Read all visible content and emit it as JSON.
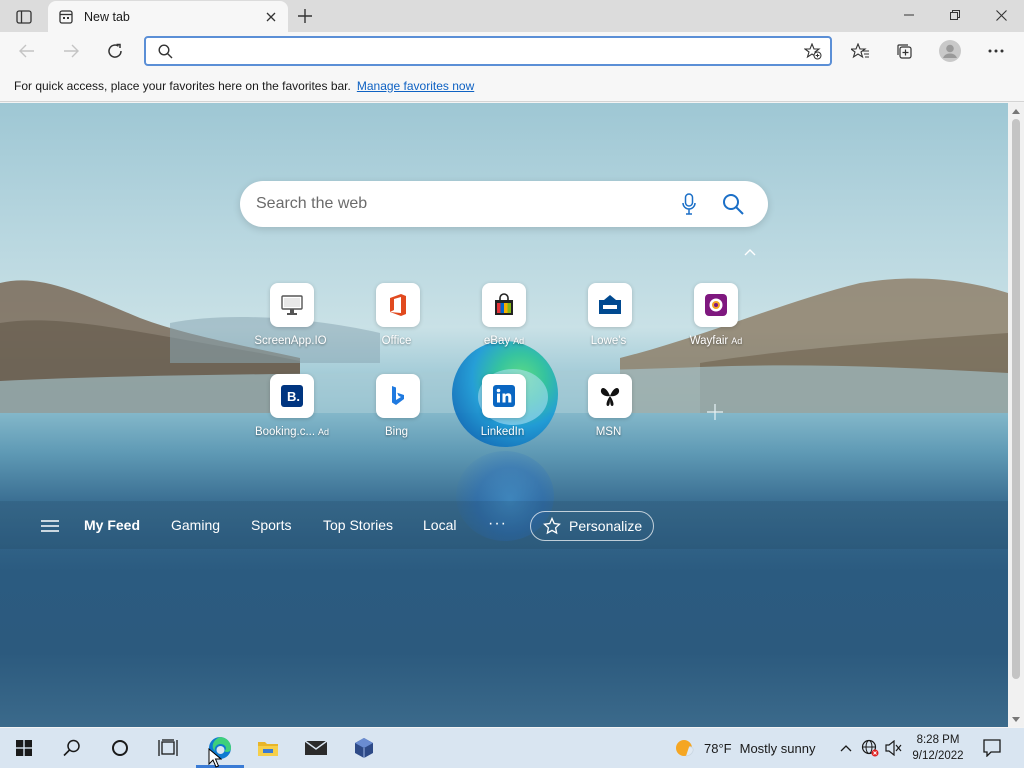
{
  "window": {
    "tab_title": "New tab"
  },
  "toolbar": {
    "address_value": "",
    "address_placeholder": ""
  },
  "favorites_bar": {
    "message": "For quick access, place your favorites here on the favorites bar.",
    "link": "Manage favorites now"
  },
  "newtab": {
    "search_placeholder": "Search the web",
    "tiles": [
      {
        "label": "ScreenApp.IO",
        "ad": ""
      },
      {
        "label": "Office",
        "ad": ""
      },
      {
        "label": "eBay",
        "ad": "Ad"
      },
      {
        "label": "Lowe's",
        "ad": ""
      },
      {
        "label": "Wayfair",
        "ad": "Ad"
      },
      {
        "label": "Booking.c...",
        "ad": "Ad"
      },
      {
        "label": "Bing",
        "ad": ""
      },
      {
        "label": "LinkedIn",
        "ad": ""
      },
      {
        "label": "MSN",
        "ad": ""
      }
    ],
    "feed_tabs": [
      "My Feed",
      "Gaming",
      "Sports",
      "Top Stories",
      "Local"
    ],
    "feed_more": "···",
    "personalize": "Personalize"
  },
  "taskbar": {
    "weather_temp": "78°F",
    "weather_text": "Mostly sunny",
    "time": "8:28 PM",
    "date": "9/12/2022"
  },
  "colors": {
    "accent": "#3a7bd5",
    "link": "#0f62c3",
    "address_border": "#5b8fd6"
  }
}
